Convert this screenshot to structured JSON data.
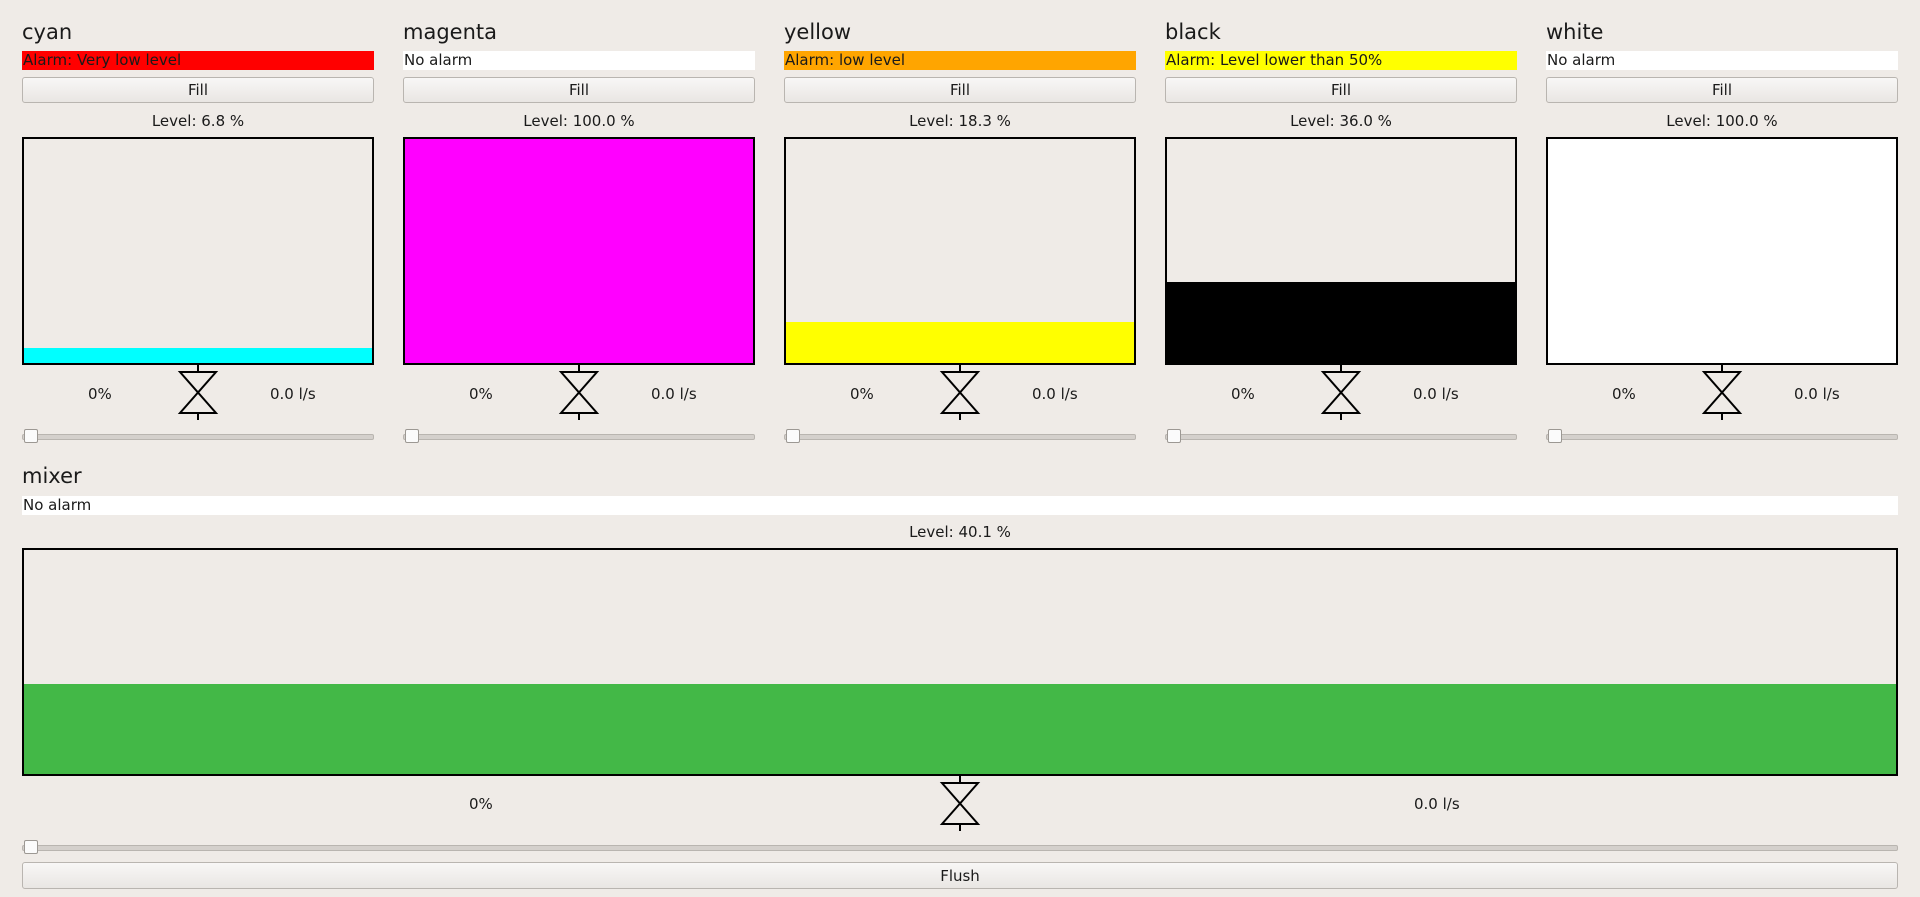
{
  "tanks": [
    {
      "name": "cyan",
      "alarm": "Alarm: Very low level",
      "alarm_color": "#ff0000",
      "fill_label": "Fill",
      "level_text": "Level: 6.8 %",
      "level": 6.8,
      "color": "#00ffff",
      "valve_pct": "0%",
      "flow": "0.0 l/s",
      "slider_value": 0
    },
    {
      "name": "magenta",
      "alarm": "No alarm",
      "alarm_color": "#ffffff",
      "fill_label": "Fill",
      "level_text": "Level: 100.0 %",
      "level": 100.0,
      "color": "#ff00ff",
      "valve_pct": "0%",
      "flow": "0.0 l/s",
      "slider_value": 0
    },
    {
      "name": "yellow",
      "alarm": "Alarm: low level",
      "alarm_color": "#ffa500",
      "fill_label": "Fill",
      "level_text": "Level: 18.3 %",
      "level": 18.3,
      "color": "#ffff00",
      "valve_pct": "0%",
      "flow": "0.0 l/s",
      "slider_value": 0
    },
    {
      "name": "black",
      "alarm": "Alarm: Level lower than 50%",
      "alarm_color": "#ffff00",
      "fill_label": "Fill",
      "level_text": "Level: 36.0 %",
      "level": 36.0,
      "color": "#000000",
      "valve_pct": "0%",
      "flow": "0.0 l/s",
      "slider_value": 0
    },
    {
      "name": "white",
      "alarm": "No alarm",
      "alarm_color": "#ffffff",
      "fill_label": "Fill",
      "level_text": "Level: 100.0 %",
      "level": 100.0,
      "color": "#ffffff",
      "valve_pct": "0%",
      "flow": "0.0 l/s",
      "slider_value": 0
    }
  ],
  "mixer": {
    "name": "mixer",
    "alarm": "No alarm",
    "alarm_color": "#ffffff",
    "level_text": "Level: 40.1 %",
    "level": 40.1,
    "color": "#43b847",
    "valve_pct": "0%",
    "flow": "0.0 l/s",
    "slider_value": 0,
    "flush_label": "Flush"
  }
}
